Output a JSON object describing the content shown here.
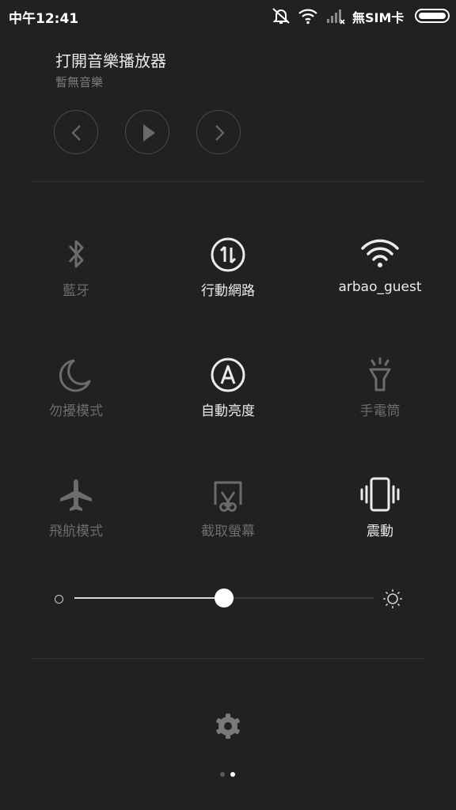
{
  "status_bar": {
    "time": "中午12:41",
    "sim_status": "無SIM卡"
  },
  "media": {
    "title": "打開音樂播放器",
    "subtitle": "暫無音樂",
    "controls": [
      "previous-icon",
      "play-icon",
      "next-icon"
    ]
  },
  "tiles": [
    {
      "label": "藍牙",
      "icon": "bluetooth-icon",
      "state": "off"
    },
    {
      "label": "行動網路",
      "icon": "mobile-data-icon",
      "state": "on"
    },
    {
      "label": "arbao_guest",
      "icon": "wifi-icon",
      "state": "on"
    },
    {
      "label": "勿擾模式",
      "icon": "moon-icon",
      "state": "off"
    },
    {
      "label": "自動亮度",
      "icon": "auto-brightness-icon",
      "state": "on"
    },
    {
      "label": "手電筒",
      "icon": "flashlight-icon",
      "state": "off"
    },
    {
      "label": "飛航模式",
      "icon": "airplane-icon",
      "state": "off"
    },
    {
      "label": "截取螢幕",
      "icon": "screenshot-icon",
      "state": "off"
    },
    {
      "label": "震動",
      "icon": "vibrate-icon",
      "state": "on"
    }
  ],
  "brightness": {
    "level": 0.5
  },
  "pager": {
    "page_count": 2,
    "active_page": 2
  },
  "colors": {
    "background": "#212123",
    "tile_on": "#ececec",
    "tile_off": "#6c6c6e"
  }
}
